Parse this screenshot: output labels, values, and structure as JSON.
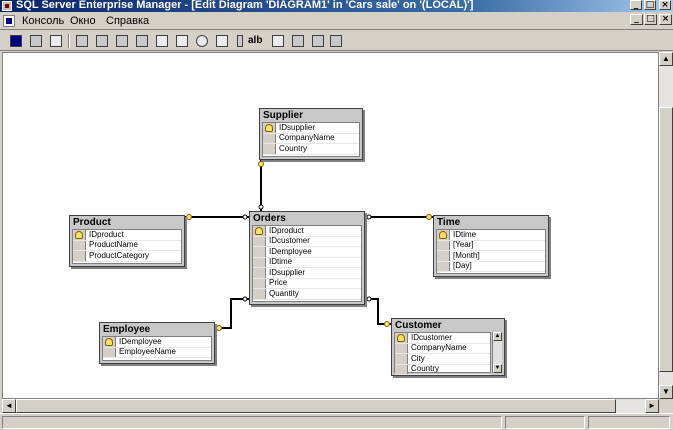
{
  "window": {
    "title": "SQL Server Enterprise Manager - [Edit Diagram 'DIAGRAM1' in 'Cars sale' on '(LOCAL)']",
    "controls": {
      "minimize": "_",
      "maximize": "□",
      "close": "×"
    }
  },
  "menu": {
    "items": [
      "Консоль",
      "Окно",
      "Справка"
    ]
  },
  "toolbar": {
    "buttons": [
      "save-icon",
      "new-table-icon",
      "print-icon",
      "cut-icon",
      "copy-icon",
      "paste-icon",
      "delete-icon",
      "table-icon",
      "add-related-icon",
      "zoom-icon",
      "layout-icon",
      "key-icon",
      "alb",
      "arrange-icon",
      "properties-icon",
      "grid-icon"
    ],
    "alb_label": "alb"
  },
  "diagram": {
    "tables": [
      {
        "name": "Supplier",
        "columns": [
          "IDsupplier",
          "CompanyName",
          "Country"
        ],
        "key_index": 0
      },
      {
        "name": "Product",
        "columns": [
          "IDproduct",
          "ProductName",
          "ProductCategory"
        ],
        "key_index": 0
      },
      {
        "name": "Orders",
        "columns": [
          "IDproduct",
          "IDcustomer",
          "IDemployee",
          "IDtime",
          "IDsupplier",
          "Price",
          "Quantity"
        ],
        "key_index": 0
      },
      {
        "name": "Time",
        "columns": [
          "IDtime",
          "[Year]",
          "[Month]",
          "[Day]"
        ],
        "key_index": 0
      },
      {
        "name": "Employee",
        "columns": [
          "IDemployee",
          "EmployeeName"
        ],
        "key_index": 0
      },
      {
        "name": "Customer",
        "columns": [
          "IDcustomer",
          "CompanyName",
          "City",
          "Country"
        ],
        "key_index": 0
      }
    ]
  },
  "colors": {
    "title_bar_start": "#0a246a",
    "title_bar_end": "#a6caf0",
    "chrome": "#d4d0c8",
    "canvas": "#ffffff",
    "table_frame": "#c8c8c8"
  }
}
